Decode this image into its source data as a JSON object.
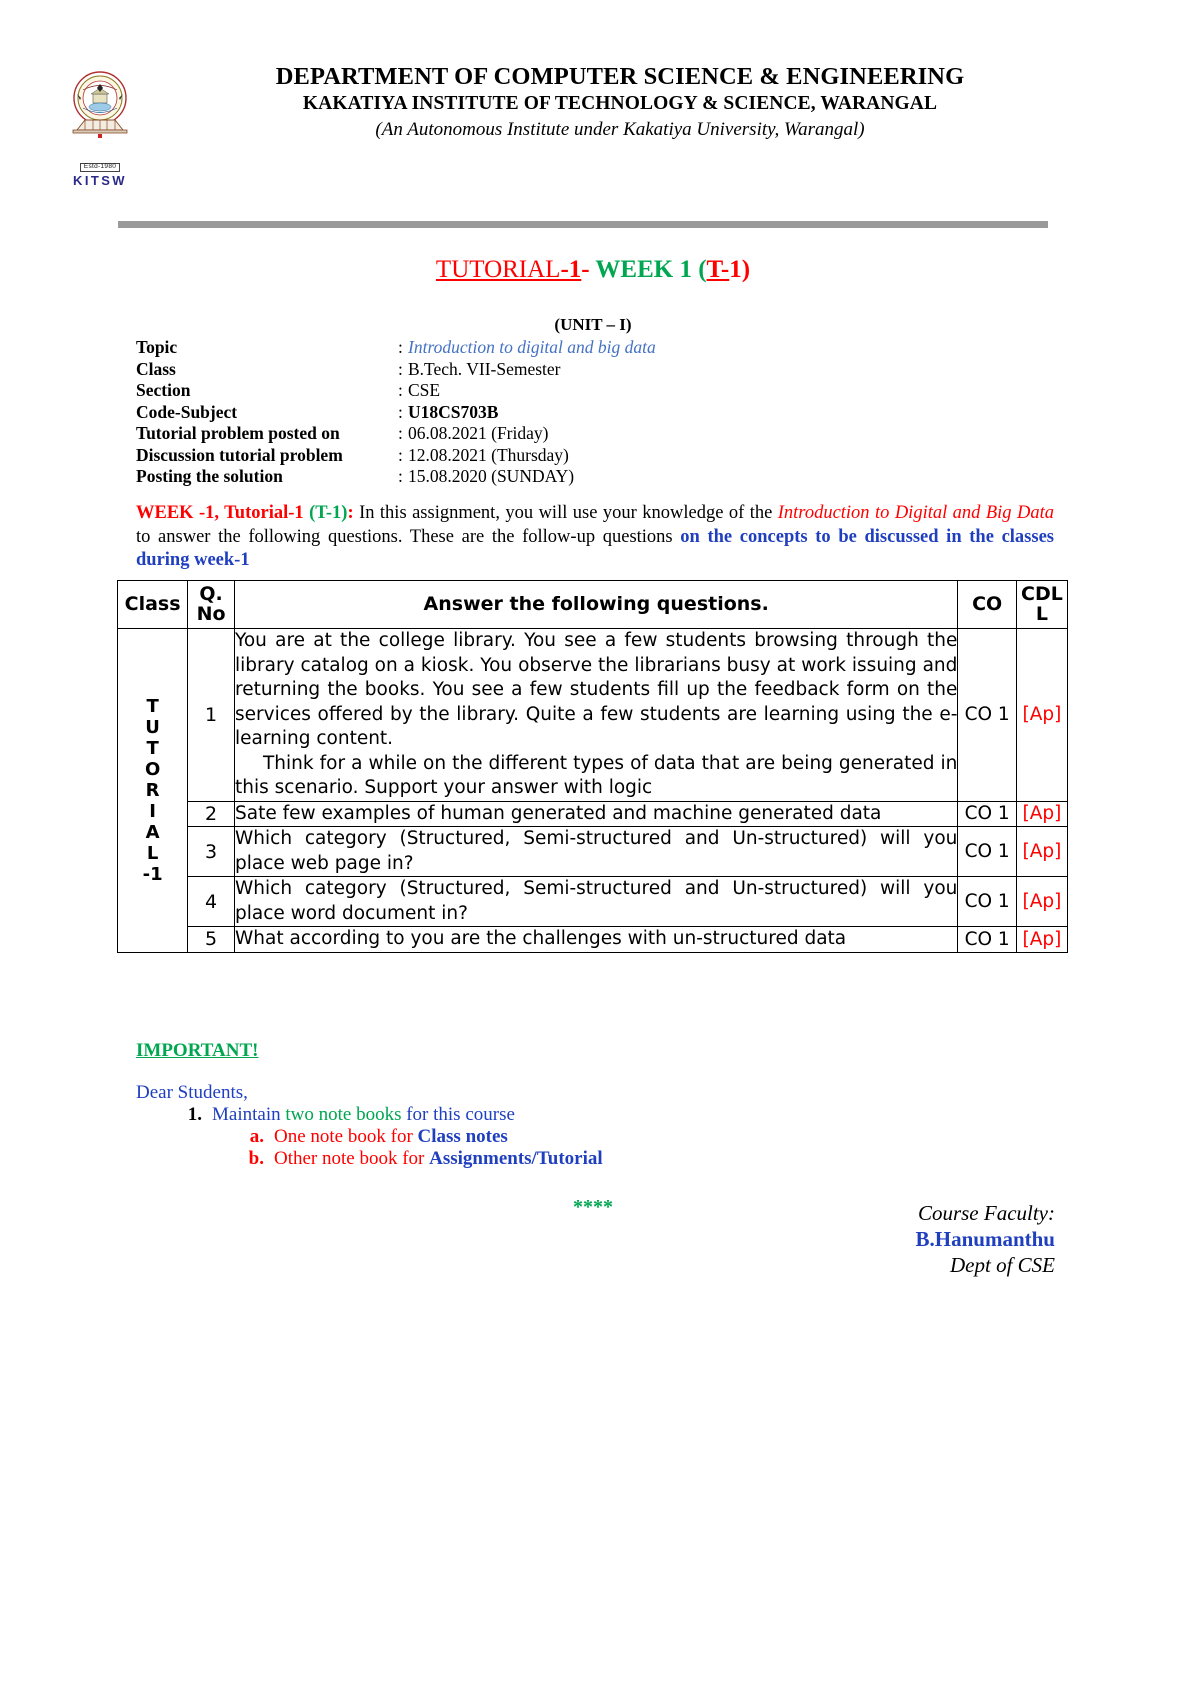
{
  "header": {
    "dept_line": "DEPARTMENT OF COMPUTER SCIENCE & ENGINEERING",
    "institute_line": "KAKATIYA INSTITUTE OF TECHNOLOGY & SCIENCE, WARANGAL",
    "autonomous_line": "(An Autonomous Institute under Kakatiya University, Warangal)",
    "logo": {
      "estd": "Estd-1980",
      "acronym": "KITSW",
      "alt": "kitsw-crest"
    }
  },
  "title": {
    "tutorial_word": " TUTORIAL",
    "tutorial_num": "-1",
    "dash": "- ",
    "week": "WEEK 1 ",
    "open_paren": "(",
    "t_dash": "T-",
    "one_close": "1)",
    "unit": "(UNIT – I)"
  },
  "meta": [
    {
      "label": "Topic",
      "colon": ":",
      "value": "Introduction to digital and big data",
      "style": "topic"
    },
    {
      "label": "Class",
      "colon": ":",
      "value": "B.Tech. VII-Semester",
      "style": "plain"
    },
    {
      "label": "Section",
      "colon": ":",
      "value": "CSE",
      "style": "plain"
    },
    {
      "label": "Code-Subject",
      "colon": ":",
      "value": "U18CS703B",
      "style": "bold"
    },
    {
      "label": "Tutorial problem posted on",
      "colon": ":",
      "value": "06.08.2021 (Friday)",
      "style": "plain"
    },
    {
      "label": "Discussion tutorial problem",
      "colon": ":",
      "value": "12.08.2021 (Thursday)",
      "style": "plain"
    },
    {
      "label": "Posting the solution",
      "colon": ":",
      "value": "15.08.2020 (SUNDAY)",
      "style": "plain"
    }
  ],
  "intro": {
    "lead_red": "WEEK -1, Tutorial-1 ",
    "lead_green": "(T-1)",
    "lead_colon": ":",
    "body1": " In this assignment, you will use your knowledge of the ",
    "emphasis": "Introduction to Digital and Big Data",
    "body2": " to answer the following questions. These are the follow-up questions ",
    "blue_tail": "on the concepts to be discussed in the classes during week-1"
  },
  "table": {
    "headers": {
      "class": "Class",
      "qno_line1": "Q.",
      "qno_line2": "No",
      "question": "Answer the following questions.",
      "co": "CO",
      "cdl_line1": "CDL",
      "cdl_line2": "L"
    },
    "class_label_letters": [
      "T",
      "U",
      "T",
      "O",
      "R",
      "I",
      "A",
      "L",
      "-1"
    ],
    "rows": [
      {
        "qno": "1",
        "question": "You are at the college library. You see a few students browsing through the library catalog on a kiosk. You observe the librarians busy at work issuing and returning the books. You see a few students fill up the feedback form on the services offered by the library. Quite a few students are learning using the e-learning content.",
        "question_second": "Think for a while on the different types of data that are being generated in this scenario. Support your answer with logic",
        "co": "CO 1",
        "cdl": "[Ap]"
      },
      {
        "qno": "2",
        "question": "Sate few examples of human generated and machine generated data",
        "question_second": "",
        "co": "CO 1",
        "cdl": "[Ap]"
      },
      {
        "qno": "3",
        "question": "Which category (Structured, Semi-structured and Un-structured) will you place web page in?",
        "question_second": "",
        "co": "CO 1",
        "cdl": "[Ap]"
      },
      {
        "qno": "4",
        "question": "Which category (Structured, Semi-structured and Un-structured) will you place word document in?",
        "question_second": "",
        "co": "CO 1",
        "cdl": "[Ap]"
      },
      {
        "qno": "5",
        "question": "What according to you are the challenges with un-structured data",
        "question_second": "",
        "co": "CO 1",
        "cdl": "[Ap]"
      }
    ]
  },
  "notes": {
    "important": "IMPORTANT!",
    "dear": "Dear Students,",
    "item1_num": "1.",
    "item1_part1": "Maintain ",
    "item1_green": "two note books",
    "item1_part2": " for this course",
    "item_a_marker": "a.",
    "item_a_text": "One note book for ",
    "item_a_bold": "Class notes",
    "item_b_marker": "b.",
    "item_b_text": "Other note book for ",
    "item_b_bold": "Assignments/Tutorial",
    "stars": "****"
  },
  "signature": {
    "role": "Course Faculty:",
    "name": "B.Hanumanthu",
    "dept": "Dept of CSE"
  },
  "colors": {
    "red": "#ff0000",
    "green": "#00a650",
    "blue": "#1f3fbf",
    "topic_blue": "#4472c4",
    "rule_gray": "#9a9a9a"
  }
}
